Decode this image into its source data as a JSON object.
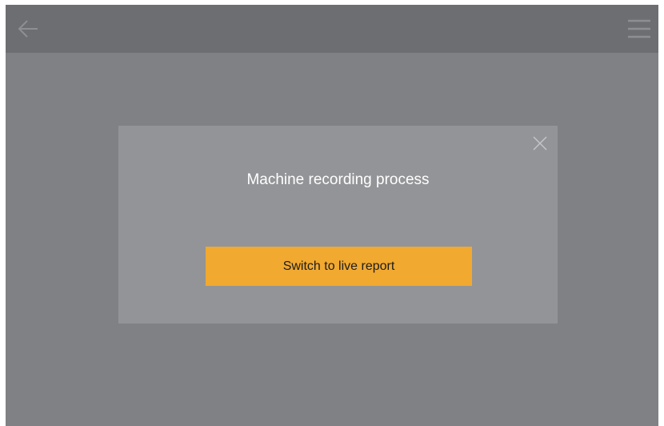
{
  "header": {
    "back_icon": "arrow-left-icon",
    "menu_icon": "hamburger-menu-icon"
  },
  "dialog": {
    "title": "Machine recording process",
    "close_icon": "close-icon",
    "primary_action_label": "Switch to live report"
  },
  "colors": {
    "background": "#808184",
    "header": "#6d6e71",
    "dialog": "#939497",
    "accent": "#f1a930",
    "icon": "#8e8f92"
  }
}
